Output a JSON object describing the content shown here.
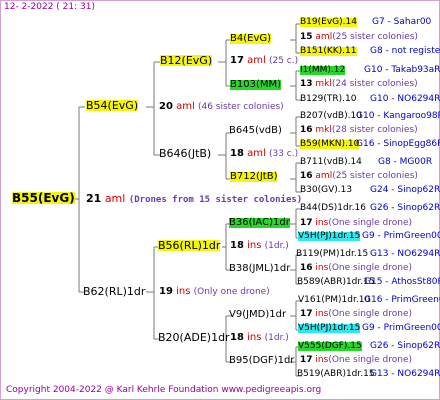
{
  "header": {
    "date": "12-  2-2022 (  21:  31)"
  },
  "footer": {
    "copyright": "Copyright 2004-2022 @ Karl Kehrle Foundation   www.pedigreeapis.org"
  },
  "colors": {
    "line": "#7a7a7a",
    "yellow": "#f5f50a",
    "green": "#28d828",
    "cyan": "#2ee8ef",
    "link": "#0000cc",
    "accent": "#9b009b"
  },
  "root": {
    "name": "B55(EvG)",
    "num": "21",
    "unit": "aml",
    "note": "(Drones from 15 sister colonies)"
  },
  "n2": [
    {
      "name": "B54(EvG)",
      "num": "20",
      "unit": "aml",
      "note": "(46 sister colonies)"
    },
    {
      "name": "B62(RL)1dr",
      "num": "19",
      "unit": "ins",
      "note": "(Only one drone)"
    }
  ],
  "n3": [
    {
      "name": "B12(EvG)",
      "num": "17",
      "unit": "aml",
      "note": "(25 c.)"
    },
    {
      "name": "B646(JtB)",
      "num": "18",
      "unit": "aml",
      "note": "(33 c.)"
    },
    {
      "name": "B56(RL)1dr",
      "num": "18",
      "unit": "ins",
      "note": "(1dr.)"
    },
    {
      "name": "B20(ADE)1dr",
      "num": "18",
      "unit": "ins",
      "note": "(1dr.)"
    }
  ],
  "n4": [
    {
      "name": "B4(EvG)",
      "num": "15",
      "unit": "aml",
      "note": "(25 sister colonies)"
    },
    {
      "name": "B103(MM)",
      "num": "13",
      "unit": "mkl",
      "note": "(24 sister colonies)"
    },
    {
      "name": "B645(vdB)",
      "num": "16",
      "unit": "mkl",
      "note": "(28 sister colonies)"
    },
    {
      "name": "B712(JtB)",
      "num": "16",
      "unit": "aml",
      "note": "(25 sister colonies)"
    },
    {
      "name": "B36(IAC)1dr",
      "num": "17",
      "unit": "ins",
      "note": "(One single drone)"
    },
    {
      "name": "B38(JML)1dr",
      "num": "16",
      "unit": "ins",
      "note": "(One single drone)"
    },
    {
      "name": "V9(JMD)1dr",
      "num": "17",
      "unit": "ins",
      "note": "(One single drone)"
    },
    {
      "name": "B95(DGF)1dr",
      "num": "17",
      "unit": "ins",
      "note": "(One single drone)"
    }
  ],
  "leaves": [
    {
      "name": "B19(EvG).14",
      "code": "G7 - Sahar00"
    },
    {
      "name": "B151(KK).11",
      "code": "G8 - not registe"
    },
    {
      "name": "I1(MM).12",
      "code": "G10 - Takab93aR"
    },
    {
      "name": "B129(TR).10",
      "code": "G10 - NO6294R"
    },
    {
      "name": "B207(vdB).10",
      "code": "G10 - Kangaroo98R"
    },
    {
      "name": "B59(MKN).10",
      "code": "G16 - SinopEgg86R"
    },
    {
      "name": "B711(vdB).14",
      "code": "G8 - MG00R"
    },
    {
      "name": "B30(GV).13",
      "code": "G24 - Sinop62R"
    },
    {
      "name": "B44(DS)1dr.16",
      "code": "G26 - Sinop62R"
    },
    {
      "name": "V5H(PJ)1dr.15",
      "code": "G9 - PrimGreen00"
    },
    {
      "name": "B119(PM)1dr.15",
      "code": "G13 - NO6294R"
    },
    {
      "name": "B589(ABR)1dr.15",
      "code": "G15 - AthosSt80R"
    },
    {
      "name": "V161(PM)1dr.10",
      "code": "G16 - PrimGreen00"
    },
    {
      "name": "V5H(PJ)1dr.15",
      "code": "G9 - PrimGreen00"
    },
    {
      "name": "V555(DGF).15",
      "code": "G26 - Sinop62R"
    },
    {
      "name": "B519(ABR)1dr.15",
      "code": "G13 - NO6294R"
    }
  ]
}
